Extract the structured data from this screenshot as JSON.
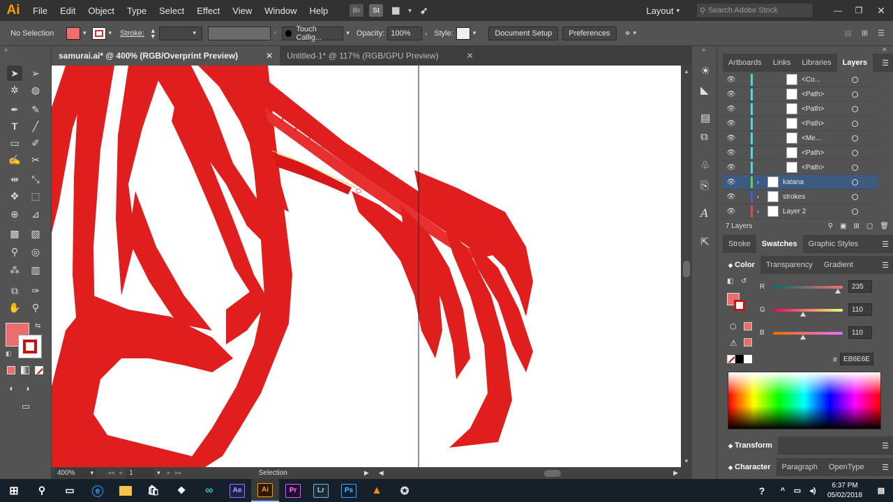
{
  "menubar": {
    "logo": "Ai",
    "items": [
      "File",
      "Edit",
      "Object",
      "Type",
      "Select",
      "Effect",
      "View",
      "Window",
      "Help"
    ],
    "workspace": "Layout",
    "search_placeholder": "Search Adobe Stock"
  },
  "controlbar": {
    "selection_label": "No Selection",
    "stroke_label": "Stroke:",
    "brush_name": "Touch Callig...",
    "opacity_label": "Opacity:",
    "opacity_value": "100%",
    "style_label": "Style:",
    "document_setup": "Document Setup",
    "preferences": "Preferences"
  },
  "tabs": [
    {
      "label": "samurai.ai* @ 400% (RGB/Overprint Preview)",
      "active": true
    },
    {
      "label": "Untitled-1* @ 117% (RGB/GPU Preview)",
      "active": false
    }
  ],
  "status": {
    "zoom": "400%",
    "page": "1",
    "tool": "Selection"
  },
  "panels": {
    "layers_tabs": [
      "Artboards",
      "Links",
      "Libraries",
      "Layers"
    ],
    "layers": [
      {
        "name": "<Co...",
        "color": "#4fd8e0"
      },
      {
        "name": "<Path>",
        "color": "#4fd8e0"
      },
      {
        "name": "<Path>",
        "color": "#4fd8e0"
      },
      {
        "name": "<Path>",
        "color": "#4fd8e0"
      },
      {
        "name": "<Me...",
        "color": "#4fd8e0"
      },
      {
        "name": "<Path>",
        "color": "#4fd8e0"
      },
      {
        "name": "<Path>",
        "color": "#4fd8e0"
      },
      {
        "name": "katana",
        "color": "#5ad44a"
      },
      {
        "name": "strokes",
        "color": "#4a5ae0"
      },
      {
        "name": "Layer 2",
        "color": "#e04a4a"
      }
    ],
    "layers_count": "7 Layers",
    "swatch_tabs": [
      "Stroke",
      "Swatches",
      "Graphic Styles"
    ],
    "color_tabs": [
      "Color",
      "Transparency",
      "Gradient"
    ],
    "color": {
      "r_label": "R",
      "r_value": "235",
      "g_label": "G",
      "g_value": "110",
      "b_label": "B",
      "b_value": "110",
      "hash": "#",
      "hex": "EB6E6E",
      "fill": "#eb6e6e"
    },
    "transform": "Transform",
    "char_tabs": [
      "Character",
      "Paragraph",
      "OpenType"
    ]
  },
  "taskbar": {
    "time": "6:37 PM",
    "date": "05/02/2018"
  }
}
